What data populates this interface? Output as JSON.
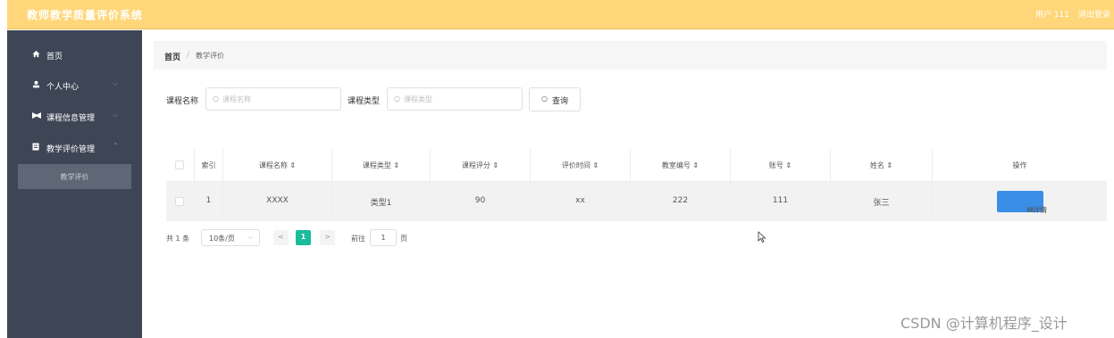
{
  "header": {
    "app_title": "教师教学质量评价系统",
    "user_label": "用户 111",
    "logout_label": "退出登录"
  },
  "sidebar": {
    "items": [
      {
        "label": "首页",
        "icon": "home-icon"
      },
      {
        "label": "个人中心",
        "icon": "user-icon"
      },
      {
        "label": "课程信息管理",
        "icon": "course-icon"
      },
      {
        "label": "教学评价管理",
        "icon": "evaluation-icon"
      }
    ],
    "sub_item": "教学评价"
  },
  "breadcrumb": {
    "home": "首页",
    "separator": "/",
    "current": "教学评价"
  },
  "search": {
    "course_name_label": "课程名称",
    "course_name_placeholder": "课程名称",
    "course_type_label": "课程类型",
    "course_type_placeholder": "课程类型",
    "query_button": "查询"
  },
  "table": {
    "headers": [
      "索引",
      "课程名称 ⇕",
      "课程类型 ⇕",
      "课程评分 ⇕",
      "评价时间 ⇕",
      "教室编号 ⇕",
      "账号 ⇕",
      "姓名 ⇕",
      "操作"
    ],
    "rows": [
      {
        "index": "1",
        "course_name": "XXXX",
        "course_type": "类型1",
        "score": "90",
        "time": "xx",
        "classroom": "222",
        "account": "111",
        "name": "张三",
        "action": "详情"
      }
    ]
  },
  "pagination": {
    "total": "共 1 条",
    "page_size": "10条/页",
    "current_page": "1",
    "goto_label": "前往",
    "goto_value": "1",
    "page_label": "页"
  },
  "watermark": "CSDN @计算机程序_设计",
  "colors": {
    "header": "#ffd77a",
    "sidebar": "#3e4656",
    "active_page": "#1abc9c",
    "detail_button": "#3a8ee6"
  }
}
